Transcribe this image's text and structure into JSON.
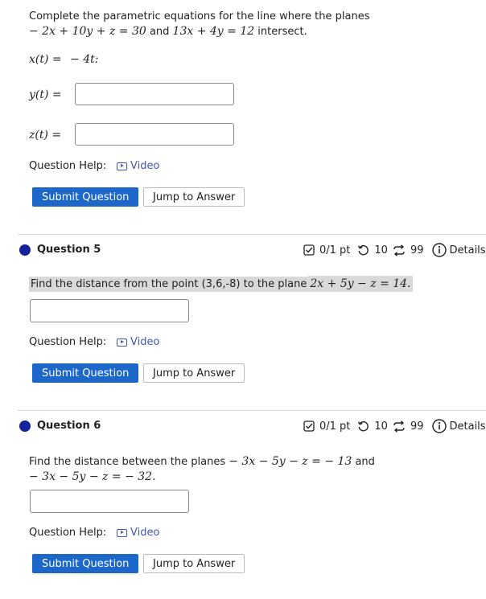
{
  "q4": {
    "prompt_line1": "Complete the parametric equations for the line where the planes",
    "plane1": "− 2x + 10y + z = 30",
    "and": "and",
    "plane2": "13x + 4y = 12",
    "intersect": "intersect.",
    "x_label": "x(t) =",
    "x_value": "− 4t:",
    "y_label": "y(t) =",
    "z_label": "z(t) =",
    "y_value": "",
    "z_value": ""
  },
  "help": {
    "label": "Question Help:",
    "video": "Video"
  },
  "buttons": {
    "submit": "Submit Question",
    "jump": "Jump to Answer"
  },
  "q5": {
    "title": "Question 5",
    "score": "0/1 pt",
    "retries": "10",
    "attempts": "99",
    "details": "Details",
    "prompt_text": "Find the distance from the point (3,6,-8) to the plane",
    "equation": "2x + 5y − z = 14.",
    "answer": ""
  },
  "q6": {
    "title": "Question 6",
    "score": "0/1 pt",
    "retries": "10",
    "attempts": "99",
    "details": "Details",
    "prompt_text": "Find the distance between the planes",
    "plane1": "− 3x − 5y − z = − 13",
    "and": "and",
    "plane2": "− 3x − 5y − z = − 32.",
    "answer": ""
  },
  "colors": {
    "primary": "#1d67c8",
    "dot": "#15239b",
    "link": "#4257b2"
  }
}
